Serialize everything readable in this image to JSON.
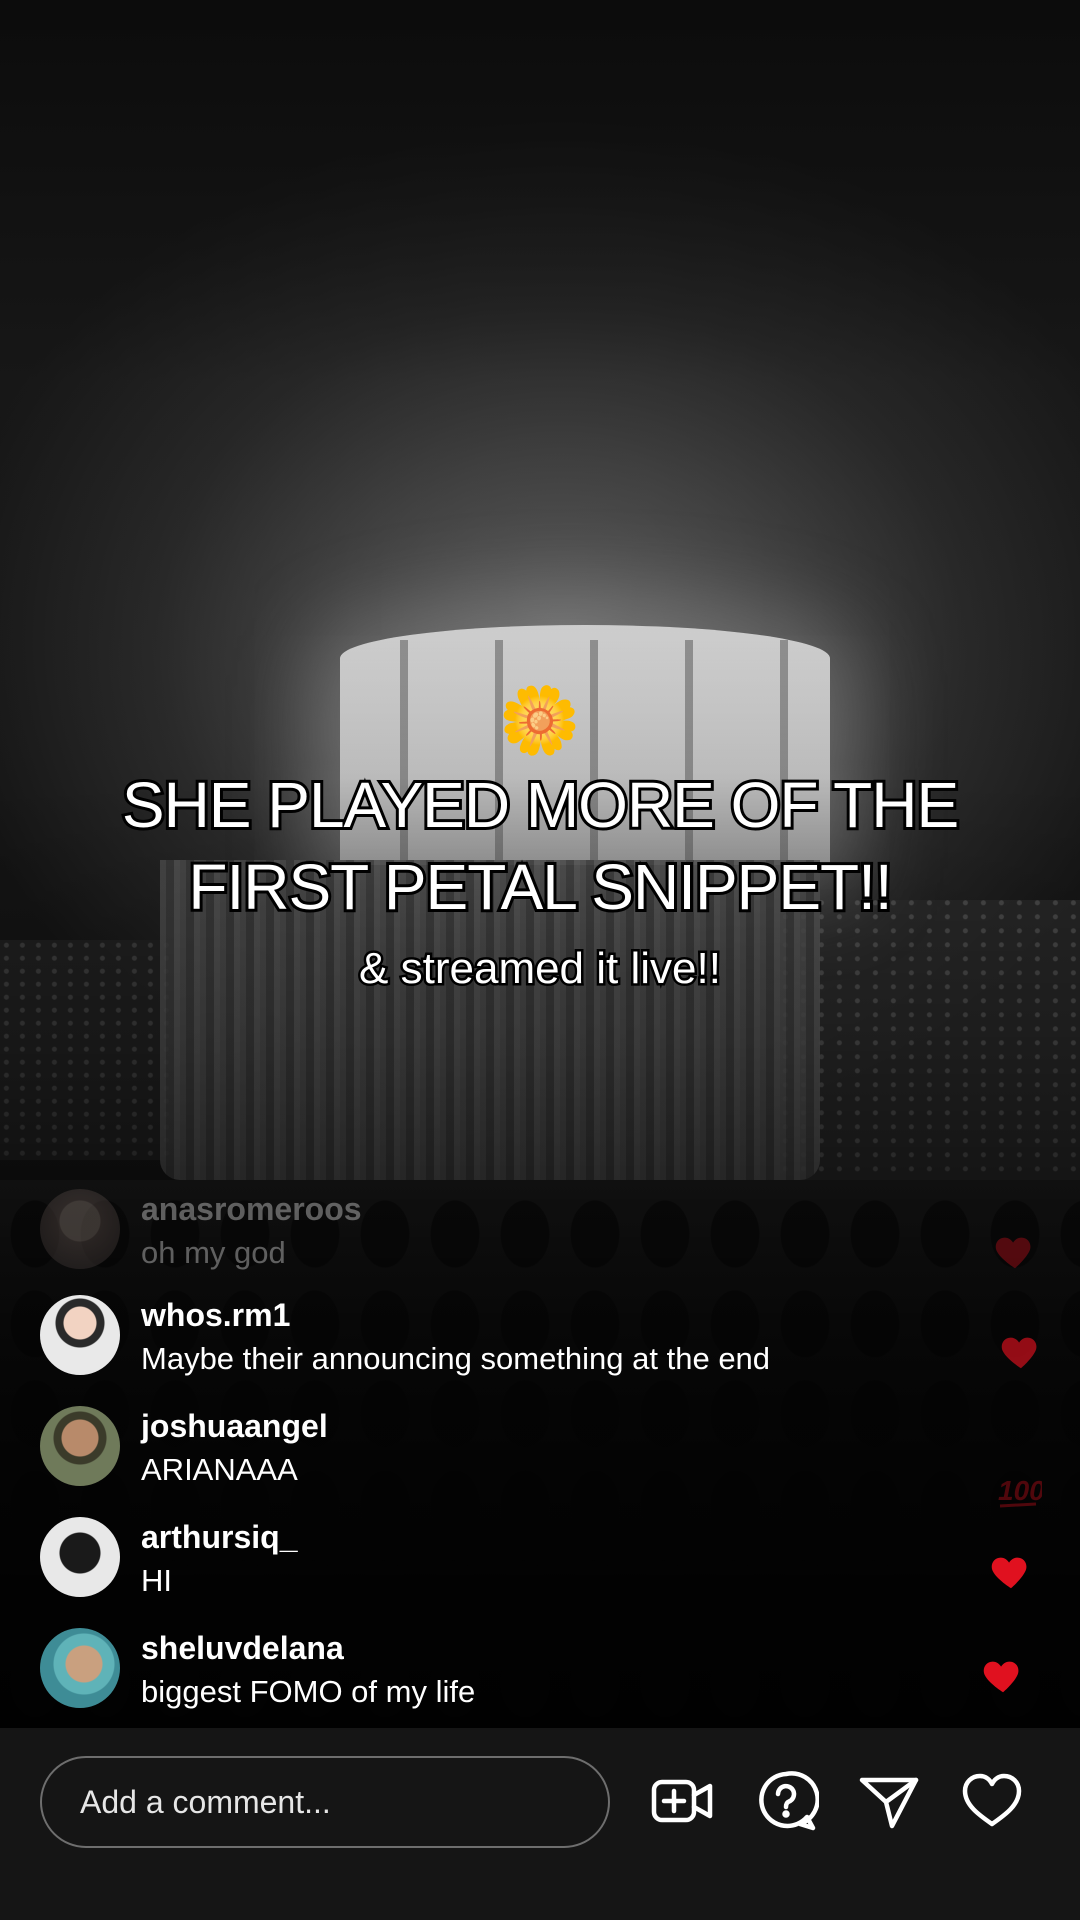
{
  "overlay": {
    "emoji": "🌼",
    "headline_line1": "SHE PLAYED MORE OF THE",
    "headline_line2": "FIRST PETAL SNIPPET!!",
    "subline": "& streamed it live!!"
  },
  "comments": [
    {
      "username": "anasromeroos",
      "text": "oh my god"
    },
    {
      "username": "whos.rm1",
      "text": "Maybe their announcing something at the end"
    },
    {
      "username": "joshuaangel",
      "text": "ARIANAAA"
    },
    {
      "username": "arthursiq_",
      "text": "HI"
    },
    {
      "username": "sheluvdelana",
      "text": "biggest FOMO of my life"
    }
  ],
  "reaction_icons": [
    "heart-reaction",
    "heart-reaction",
    "hundred-reaction",
    "heart-reaction",
    "heart-reaction"
  ],
  "bottom_bar": {
    "comment_placeholder": "Add a comment...",
    "icons": [
      "add-video-icon",
      "question-icon",
      "share-icon",
      "like-heart-icon"
    ]
  },
  "colors": {
    "reaction_red": "#e0111f",
    "bar_background": "#151515",
    "text": "#ffffff"
  }
}
